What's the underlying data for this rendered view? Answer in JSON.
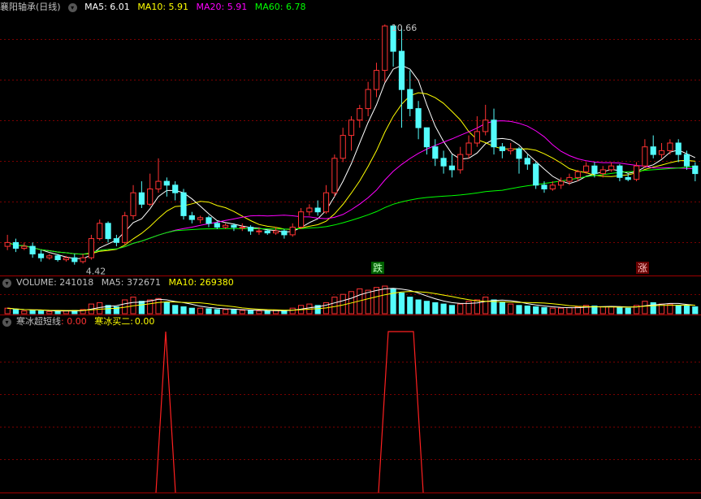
{
  "colors": {
    "up": "#ff3232",
    "down": "#54fcfc",
    "grid": "#7a0000",
    "axis": "#a00000",
    "ma5": "#ffffff",
    "ma10": "#ffff00",
    "ma20": "#ff00ff",
    "ma60": "#00ff00",
    "osc": "#ff2020",
    "label": "#c0c0c0"
  },
  "main_panel": {
    "stock_name": "襄阳轴承(日线)",
    "ma5": "MA5: 6.01",
    "ma10": "MA10: 5.91",
    "ma20": "MA20: 5.91",
    "ma60": "MA60: 6.78",
    "high_label": "10.66",
    "low_label": "4.42",
    "signal_down": "跌",
    "signal_up": "涨"
  },
  "volume_panel": {
    "title": "VOLUME: 241018",
    "ma5": "MA5: 372671",
    "ma10": "MA10: 269380"
  },
  "indicator_panel": {
    "title": "寒冰超短线",
    "value1": ": 0.00",
    "label2": "寒冰买二:",
    "value2": "0.00"
  },
  "chart_data": {
    "type": "candlestick",
    "price_range": [
      4.2,
      11.0
    ],
    "candles": [
      [
        4.9,
        5.0,
        4.8,
        5.2
      ],
      [
        5.0,
        4.85,
        4.75,
        5.1
      ],
      [
        4.85,
        4.9,
        4.8,
        5.0
      ],
      [
        4.9,
        4.7,
        4.6,
        5.0
      ],
      [
        4.7,
        4.6,
        4.5,
        4.8
      ],
      [
        4.6,
        4.65,
        4.55,
        4.7
      ],
      [
        4.65,
        4.55,
        4.5,
        4.7
      ],
      [
        4.55,
        4.6,
        4.5,
        4.65
      ],
      [
        4.6,
        4.5,
        4.42,
        4.7
      ],
      [
        4.5,
        4.6,
        4.45,
        4.7
      ],
      [
        4.6,
        5.1,
        4.55,
        5.2
      ],
      [
        5.1,
        5.5,
        5.05,
        5.6
      ],
      [
        5.5,
        5.1,
        5.0,
        5.55
      ],
      [
        5.1,
        5.0,
        4.9,
        5.2
      ],
      [
        5.0,
        5.7,
        4.95,
        5.8
      ],
      [
        5.7,
        6.3,
        5.6,
        6.5
      ],
      [
        6.3,
        6.0,
        5.9,
        6.6
      ],
      [
        6.0,
        6.4,
        5.95,
        6.8
      ],
      [
        6.4,
        6.6,
        6.3,
        7.2
      ],
      [
        6.6,
        6.5,
        6.2,
        6.7
      ],
      [
        6.5,
        6.3,
        6.1,
        6.6
      ],
      [
        6.3,
        5.7,
        5.6,
        6.4
      ],
      [
        5.7,
        5.6,
        5.5,
        5.8
      ],
      [
        5.6,
        5.65,
        5.5,
        5.7
      ],
      [
        5.65,
        5.5,
        5.4,
        5.7
      ],
      [
        5.5,
        5.4,
        5.35,
        5.55
      ],
      [
        5.4,
        5.45,
        5.35,
        5.5
      ],
      [
        5.45,
        5.4,
        5.3,
        5.5
      ],
      [
        5.4,
        5.4,
        5.3,
        5.5
      ],
      [
        5.4,
        5.3,
        5.2,
        5.45
      ],
      [
        5.3,
        5.3,
        5.2,
        5.4
      ],
      [
        5.3,
        5.25,
        5.2,
        5.35
      ],
      [
        5.25,
        5.3,
        5.2,
        5.4
      ],
      [
        5.3,
        5.2,
        5.1,
        5.35
      ],
      [
        5.2,
        5.4,
        5.15,
        5.5
      ],
      [
        5.4,
        5.8,
        5.35,
        5.9
      ],
      [
        5.8,
        5.9,
        5.7,
        6.0
      ],
      [
        5.9,
        5.8,
        5.7,
        6.1
      ],
      [
        5.8,
        6.3,
        5.75,
        6.5
      ],
      [
        6.3,
        7.2,
        6.2,
        7.3
      ],
      [
        7.2,
        7.8,
        7.1,
        8.0
      ],
      [
        7.8,
        8.2,
        7.4,
        8.3
      ],
      [
        8.2,
        8.5,
        8.0,
        8.6
      ],
      [
        8.5,
        9.0,
        8.3,
        9.2
      ],
      [
        9.0,
        9.5,
        8.8,
        9.7
      ],
      [
        9.5,
        10.66,
        9.2,
        10.7
      ],
      [
        10.66,
        10.0,
        9.6,
        10.6
      ],
      [
        10.0,
        9.0,
        8.0,
        10.66
      ],
      [
        9.0,
        8.5,
        8.3,
        9.5
      ],
      [
        8.5,
        8.0,
        7.7,
        8.7
      ],
      [
        8.0,
        7.5,
        7.3,
        8.0
      ],
      [
        7.5,
        7.2,
        7.0,
        7.7
      ],
      [
        7.2,
        7.0,
        6.8,
        7.4
      ],
      [
        7.0,
        6.9,
        6.7,
        7.3
      ],
      [
        6.9,
        7.3,
        6.8,
        7.5
      ],
      [
        7.3,
        7.6,
        7.2,
        7.8
      ],
      [
        7.6,
        7.9,
        7.5,
        8.3
      ],
      [
        7.9,
        8.2,
        7.8,
        8.6
      ],
      [
        8.2,
        7.5,
        7.3,
        8.5
      ],
      [
        7.5,
        7.4,
        7.2,
        7.6
      ],
      [
        7.4,
        7.45,
        7.3,
        7.6
      ],
      [
        7.45,
        7.2,
        6.8,
        7.5
      ],
      [
        7.2,
        7.05,
        6.9,
        7.3
      ],
      [
        7.05,
        6.5,
        6.4,
        7.1
      ],
      [
        6.5,
        6.4,
        6.3,
        6.6
      ],
      [
        6.4,
        6.5,
        6.35,
        6.6
      ],
      [
        6.5,
        6.6,
        6.4,
        6.7
      ],
      [
        6.6,
        6.7,
        6.5,
        6.8
      ],
      [
        6.7,
        6.85,
        6.6,
        6.9
      ],
      [
        6.85,
        7.0,
        6.8,
        7.1
      ],
      [
        7.0,
        6.8,
        6.7,
        7.1
      ],
      [
        6.8,
        6.9,
        6.7,
        7.0
      ],
      [
        6.9,
        7.0,
        6.85,
        7.1
      ],
      [
        7.0,
        6.7,
        6.6,
        7.05
      ],
      [
        6.7,
        6.65,
        6.6,
        6.8
      ],
      [
        6.65,
        7.0,
        6.6,
        7.1
      ],
      [
        7.0,
        7.5,
        6.95,
        7.7
      ],
      [
        7.5,
        7.3,
        7.2,
        7.8
      ],
      [
        7.3,
        7.4,
        7.2,
        7.6
      ],
      [
        7.4,
        7.6,
        7.3,
        7.7
      ],
      [
        7.6,
        7.3,
        7.1,
        7.7
      ],
      [
        7.3,
        7.0,
        6.9,
        7.4
      ],
      [
        7.0,
        6.8,
        6.6,
        7.1
      ]
    ],
    "volumes": [
      0.2,
      0.15,
      0.1,
      0.12,
      0.1,
      0.08,
      0.1,
      0.1,
      0.12,
      0.15,
      0.35,
      0.4,
      0.3,
      0.25,
      0.5,
      0.6,
      0.45,
      0.5,
      0.55,
      0.4,
      0.3,
      0.25,
      0.2,
      0.2,
      0.18,
      0.15,
      0.15,
      0.14,
      0.12,
      0.12,
      0.1,
      0.1,
      0.12,
      0.1,
      0.2,
      0.3,
      0.35,
      0.3,
      0.4,
      0.6,
      0.7,
      0.8,
      0.9,
      0.85,
      0.95,
      1.0,
      0.9,
      0.75,
      0.6,
      0.5,
      0.45,
      0.4,
      0.35,
      0.3,
      0.35,
      0.45,
      0.5,
      0.6,
      0.5,
      0.4,
      0.35,
      0.3,
      0.28,
      0.25,
      0.22,
      0.2,
      0.2,
      0.22,
      0.25,
      0.3,
      0.28,
      0.25,
      0.25,
      0.22,
      0.2,
      0.3,
      0.45,
      0.4,
      0.35,
      0.35,
      0.3,
      0.28,
      0.25
    ],
    "oscillator_pulses": [
      [
        200,
        208
      ],
      [
        472,
        515
      ]
    ]
  }
}
